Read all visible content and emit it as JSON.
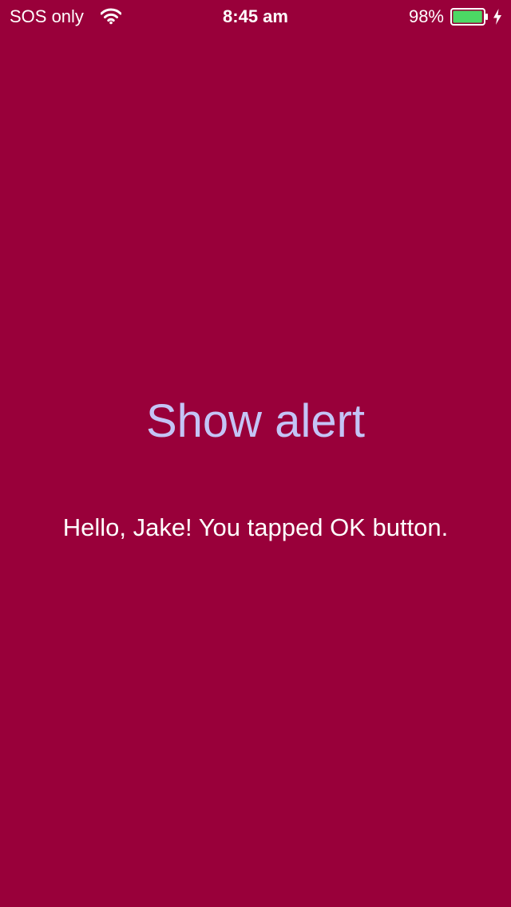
{
  "colors": {
    "background": "#99003a",
    "accent": "#c4c4f6",
    "text": "#ffffff",
    "battery_fill": "#4cd964"
  },
  "status_bar": {
    "carrier": "SOS only",
    "time": "8:45 am",
    "battery_percent": "98%",
    "battery_level": 0.98,
    "icons": [
      "wifi-icon",
      "battery-icon",
      "charging-bolt-icon"
    ]
  },
  "main": {
    "show_alert_label": "Show alert",
    "message": "Hello, Jake! You tapped OK button."
  }
}
